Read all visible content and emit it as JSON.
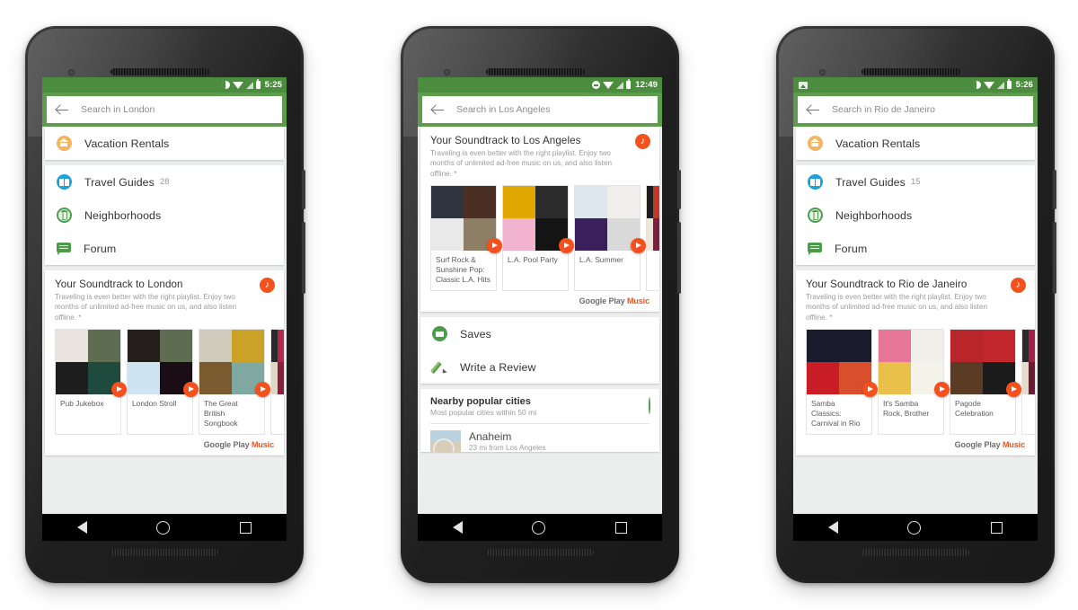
{
  "page": {
    "background": "#ffffff",
    "accent_green": "#5d9c4c",
    "statusbar_green": "#4c8c3f",
    "orange": "#f4511e"
  },
  "shared": {
    "music_description": "Traveling is even better with the right playlist. Enjoy two months of unlimited ad-free music on us, and also listen offline. *",
    "brand_google_play": "Google Play",
    "brand_music": "Music",
    "vacation_rentals_label": "Vacation Rentals",
    "travel_guides_label": "Travel Guides",
    "neighborhoods_label": "Neighborhoods",
    "forum_label": "Forum"
  },
  "phones": [
    {
      "id": "phone-london",
      "statusbar": {
        "time": "5:25",
        "left_icons": [],
        "right_icons": [
          "do-not-disturb-icon",
          "wifi-icon",
          "signal-icon",
          "battery-icon"
        ]
      },
      "search": {
        "placeholder": "Search in London",
        "back_icon": "back-arrow-icon"
      },
      "sections": {
        "vacation_rentals": "Vacation Rentals",
        "travel_guides": "Travel Guides",
        "travel_guides_count": "28",
        "neighborhoods": "Neighborhoods",
        "forum": "Forum"
      },
      "music": {
        "title": "Your Soundtrack to London",
        "description": "Traveling is even better with the right playlist. Enjoy two months of unlimited ad-free music on us, and also listen offline. *",
        "badge_icon": "music-note-icon",
        "brand": "Google Play Music",
        "playlists": [
          {
            "name": "Pub Jukebox",
            "colors": [
              "#e8e3dc",
              "#5e6d52",
              "#1d1d1d",
              "#1f4a3e"
            ]
          },
          {
            "name": "London Stroll",
            "colors": [
              "#241f1c",
              "#5e6d52",
              "#cfe4f2",
              "#1a0d16"
            ]
          },
          {
            "name": "The Great British Songbook",
            "colors": [
              "#cfcabb",
              "#c9a227",
              "#7a5a2e",
              "#7fa8a0"
            ]
          },
          {
            "name": "",
            "colors": [
              "#2a2a2a",
              "#b3294e",
              "#e0d6c6",
              "#8a1f3d"
            ]
          }
        ]
      }
    },
    {
      "id": "phone-los-angeles",
      "statusbar": {
        "time": "12:49",
        "left_icons": [],
        "right_icons": [
          "do-not-disturb-icon",
          "wifi-icon",
          "signal-icon",
          "battery-icon"
        ]
      },
      "search": {
        "placeholder": "Search in Los Angeles",
        "back_icon": "back-arrow-icon"
      },
      "music": {
        "title": "Your Soundtrack to Los Angeles",
        "description": "Traveling is even better with the right playlist. Enjoy two months of unlimited ad-free music on us, and also listen offline. *",
        "badge_icon": "music-note-icon",
        "brand": "Google Play Music",
        "playlists": [
          {
            "name": "Surf Rock & Sunshine Pop: Classic L.A. Hits",
            "colors": [
              "#2f3440",
              "#4a2f22",
              "#e9e9ea",
              "#8c7f66"
            ]
          },
          {
            "name": "L.A. Pool Party",
            "colors": [
              "#e0a800",
              "#2b2b2b",
              "#f2b3cf",
              "#141414"
            ]
          },
          {
            "name": "L.A. Summer",
            "colors": [
              "#dfe7ee",
              "#efeeea",
              "#3a1f5c",
              "#d9d9d9"
            ]
          },
          {
            "name": "",
            "colors": [
              "#1d1d1d",
              "#c0392b",
              "#efe6d8",
              "#7a1f3d"
            ]
          }
        ]
      },
      "actions": {
        "saves": "Saves",
        "write_review": "Write a Review",
        "saves_icon": "heart-badge-icon",
        "review_icon": "pencil-icon"
      },
      "nearby": {
        "title": "Nearby popular cities",
        "subtitle": "Most popular cities within 50 mi",
        "icon": "globe-icon",
        "cities": [
          {
            "name": "Anaheim",
            "distance": "23 mi from Los Angeles"
          }
        ]
      }
    },
    {
      "id": "phone-rio",
      "statusbar": {
        "time": "5:26",
        "left_icons": [
          "screenshot-icon"
        ],
        "right_icons": [
          "do-not-disturb-icon",
          "wifi-icon",
          "signal-icon",
          "battery-icon"
        ]
      },
      "search": {
        "placeholder": "Search in Rio de Janeiro",
        "back_icon": "back-arrow-icon"
      },
      "sections": {
        "vacation_rentals": "Vacation Rentals",
        "travel_guides": "Travel Guides",
        "travel_guides_count": "15",
        "neighborhoods": "Neighborhoods",
        "forum": "Forum"
      },
      "music": {
        "title": "Your Soundtrack to Rio de Janeiro",
        "description": "Traveling is even better with the right playlist. Enjoy two months of unlimited ad-free music on us, and also listen offline. *",
        "badge_icon": "music-note-icon",
        "brand": "Google Play Music",
        "playlists": [
          {
            "name": "Samba Classics: Carnival in Rio",
            "colors": [
              "#1b1b2e",
              "#1b1b2e",
              "#c81d25",
              "#d94f2b"
            ]
          },
          {
            "name": "It's Samba Rock, Brother",
            "colors": [
              "#e8759a",
              "#f0efe9",
              "#e8c04a",
              "#f5f2ea"
            ]
          },
          {
            "name": "Pagode Celebration",
            "colors": [
              "#b8252b",
              "#c1272d",
              "#5a3b24",
              "#1c1c1c"
            ]
          },
          {
            "name": "",
            "colors": [
              "#2a2a2a",
              "#a31f4a",
              "#e6dccb",
              "#6f1a35"
            ]
          }
        ]
      }
    }
  ],
  "navbar": {
    "back": "back-nav-icon",
    "home": "home-nav-icon",
    "recents": "recents-nav-icon"
  }
}
